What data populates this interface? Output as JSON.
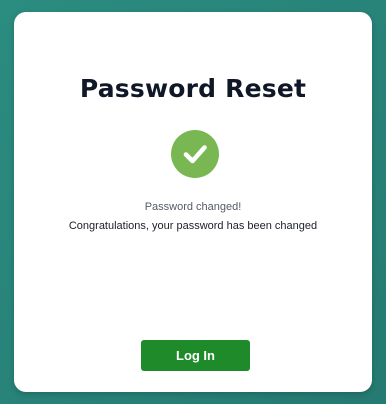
{
  "card": {
    "title": "Password Reset",
    "icon": "check-circle-icon",
    "status_text": "Password changed!",
    "message": "Congratulations, your password has been changed",
    "login_label": "Log In"
  },
  "colors": {
    "background": "#2b8c80",
    "card": "#ffffff",
    "check_circle": "#79b752",
    "button": "#1f8a2a",
    "title": "#101828"
  }
}
